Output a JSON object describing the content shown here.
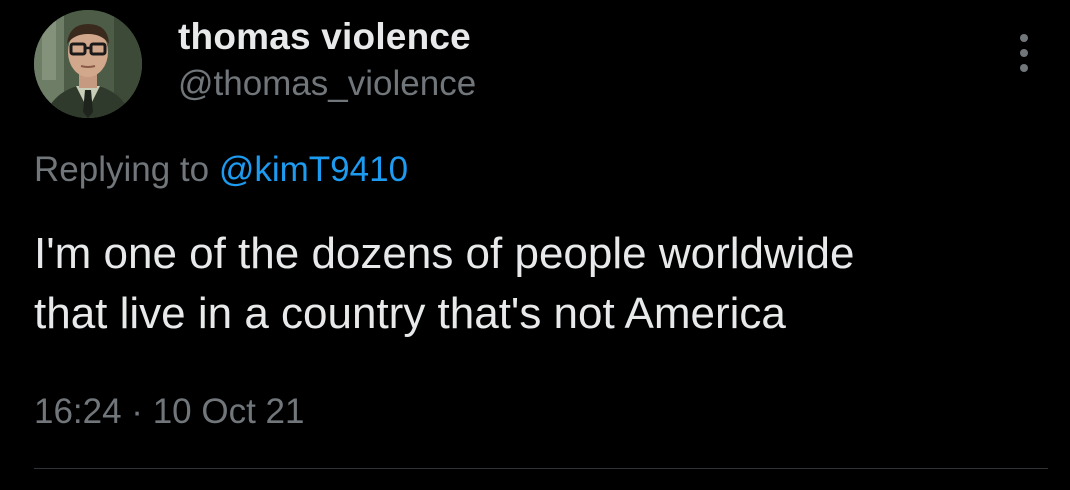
{
  "tweet": {
    "author": {
      "display_name": "thomas violence",
      "handle": "@thomas_violence",
      "avatar_icon": "profile-photo"
    },
    "more_icon": "more-vertical-icon",
    "reply": {
      "prefix": "Replying to",
      "mention": "@kimT9410"
    },
    "text_lines": [
      "I'm one of the dozens of people worldwide",
      "that live in a country that's not America"
    ],
    "timestamp": "16:24 · 10 Oct 21"
  },
  "colors": {
    "background": "#000000",
    "text_primary": "#e7e9ea",
    "text_secondary": "#71767b",
    "link": "#1d9bf0",
    "divider": "#2f3336"
  }
}
